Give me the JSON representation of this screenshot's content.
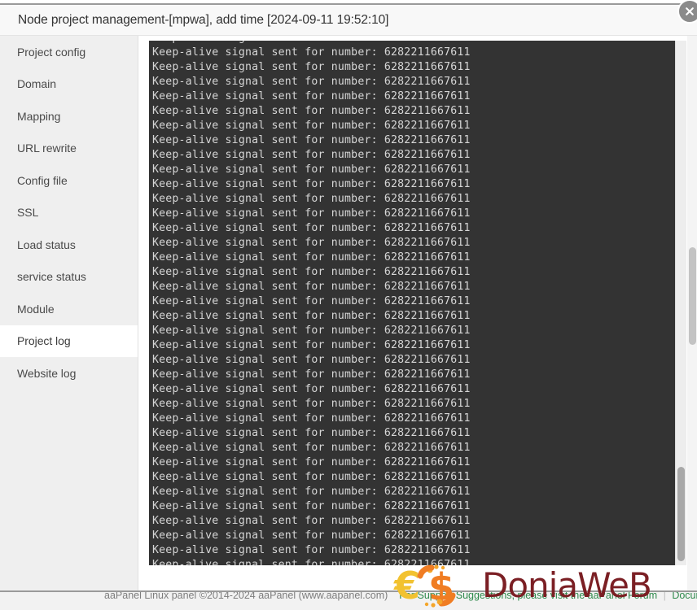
{
  "window": {
    "title": "Node project management-[mpwa], add time [2024-09-11 19:52:10]",
    "close_icon": "close-circle-icon"
  },
  "sidebar": {
    "items": [
      {
        "label": "Project config",
        "active": false
      },
      {
        "label": "Domain",
        "active": false
      },
      {
        "label": "Mapping",
        "active": false
      },
      {
        "label": "URL rewrite",
        "active": false
      },
      {
        "label": "Config file",
        "active": false
      },
      {
        "label": "SSL",
        "active": false
      },
      {
        "label": "Load status",
        "active": false
      },
      {
        "label": "service status",
        "active": false
      },
      {
        "label": "Module",
        "active": false
      },
      {
        "label": "Project log",
        "active": true
      },
      {
        "label": "Website log",
        "active": false
      }
    ]
  },
  "log": {
    "line_text": "Keep-alive signal sent for number: 6282211667611",
    "line_count": 37,
    "background": "#333333",
    "text_color": "#d6d6d6"
  },
  "footer": {
    "copyright": "aaPanel Linux panel ©2014-2024 aaPanel (www.aapanel.com)",
    "support": "For Support Suggestions, please visit the aaPanel Forum",
    "separator": "|",
    "docs": "Docum"
  },
  "watermark": {
    "text": "DoniaWeB",
    "euro_symbol": "€",
    "dollar_symbol": "$",
    "euro_color": "#f2c230",
    "dollar_color": "#f07d23",
    "text_color": "#7b1f24"
  }
}
